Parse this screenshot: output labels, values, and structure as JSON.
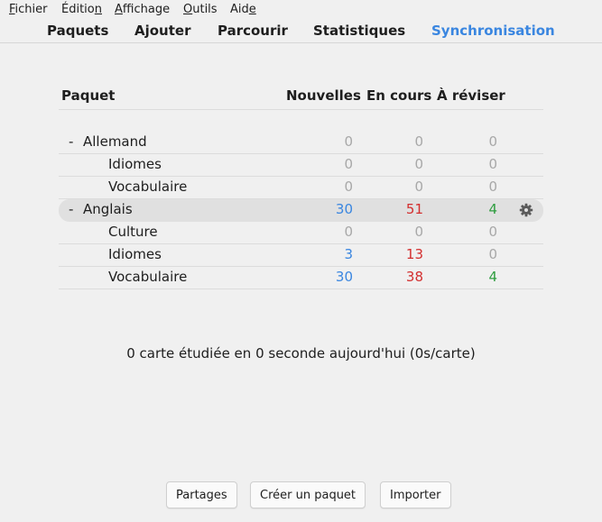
{
  "menu": {
    "items": [
      {
        "before": "",
        "mnemonic": "F",
        "after": "ichier"
      },
      {
        "before": "Éditio",
        "mnemonic": "n",
        "after": ""
      },
      {
        "before": "",
        "mnemonic": "A",
        "after": "ffichage"
      },
      {
        "before": "",
        "mnemonic": "O",
        "after": "utils"
      },
      {
        "before": "Aid",
        "mnemonic": "e",
        "after": ""
      }
    ]
  },
  "toolbar": {
    "decks": "Paquets",
    "add": "Ajouter",
    "browse": "Parcourir",
    "stats": "Statistiques",
    "sync": "Synchronisation",
    "sync_color": "#3a86e0"
  },
  "table": {
    "headers": {
      "deck": "Paquet",
      "new": "Nouvelles",
      "learn": "En cours",
      "due": "À réviser"
    },
    "rows": [
      {
        "collapse": "-",
        "name": "Allemand",
        "new": "0",
        "learn": "0",
        "due": "0"
      },
      {
        "collapse": "",
        "name": "Idiomes",
        "new": "0",
        "learn": "0",
        "due": "0"
      },
      {
        "collapse": "",
        "name": "Vocabulaire",
        "new": "0",
        "learn": "0",
        "due": "0"
      },
      {
        "collapse": "-",
        "name": "Anglais",
        "new": "30",
        "learn": "51",
        "due": "4",
        "current": true
      },
      {
        "collapse": "",
        "name": "Culture",
        "new": "0",
        "learn": "0",
        "due": "0"
      },
      {
        "collapse": "",
        "name": "Idiomes",
        "new": "3",
        "learn": "13",
        "due": "0"
      },
      {
        "collapse": "",
        "name": "Vocabulaire",
        "new": "30",
        "learn": "38",
        "due": "4"
      }
    ]
  },
  "colors": {
    "new": "#3a86e0",
    "learn": "#d32f2f",
    "due": "#2e9d3f",
    "zero": "#a8a8a8"
  },
  "icons": {
    "options": "gear-icon"
  },
  "stats_text": "0 carte étudiée en 0 seconde aujourd'hui (0s/carte)",
  "buttons": {
    "shared": "Partages",
    "create": "Créer un paquet",
    "import": "Importer"
  }
}
